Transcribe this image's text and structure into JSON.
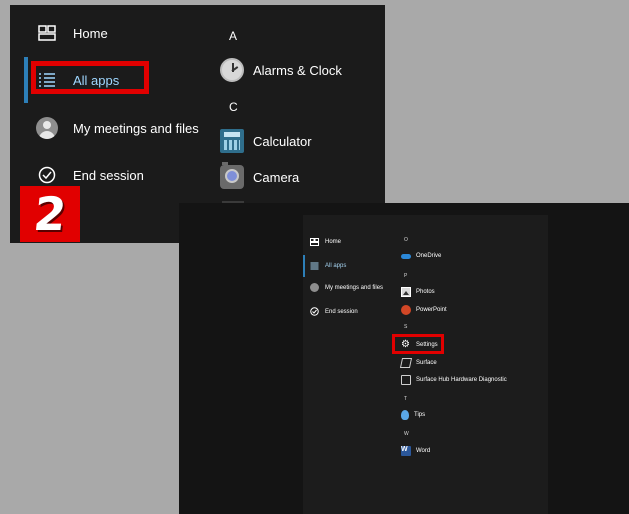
{
  "top_panel": {
    "nav": [
      {
        "label": "Home",
        "icon": "home-grid-icon"
      },
      {
        "label": "All apps",
        "icon": "list-icon",
        "active": true
      },
      {
        "label": "My meetings and files",
        "icon": "avatar-icon"
      },
      {
        "label": "End session",
        "icon": "check-circle-icon"
      }
    ],
    "letters": [
      "A",
      "C"
    ],
    "apps": [
      {
        "label": "Alarms & Clock",
        "icon": "clock-icon"
      },
      {
        "label": "Calculator",
        "icon": "calculator-icon"
      },
      {
        "label": "Camera",
        "icon": "camera-icon"
      }
    ],
    "step_badge": "2"
  },
  "bottom_panel": {
    "nav": [
      {
        "label": "Home",
        "icon": "home-grid-icon"
      },
      {
        "label": "All apps",
        "icon": "list-icon",
        "active": true
      },
      {
        "label": "My meetings and files",
        "icon": "avatar-icon"
      },
      {
        "label": "End session",
        "icon": "check-circle-icon"
      }
    ],
    "letters": [
      "O",
      "P",
      "S",
      "T",
      "W"
    ],
    "apps": [
      {
        "label": "OneDrive",
        "icon": "onedrive-icon"
      },
      {
        "label": "Photos",
        "icon": "photos-icon"
      },
      {
        "label": "PowerPoint",
        "icon": "powerpoint-icon"
      },
      {
        "label": "Settings",
        "icon": "gear-icon",
        "highlighted": true
      },
      {
        "label": "Surface",
        "icon": "surface-icon"
      },
      {
        "label": "Surface Hub Hardware Diagnostic",
        "icon": "hub-diagnostic-icon"
      },
      {
        "label": "Tips",
        "icon": "tips-icon"
      },
      {
        "label": "Word",
        "icon": "word-icon"
      }
    ]
  },
  "colors": {
    "highlight_red": "#e10000",
    "accent_blue": "#2d7fb8",
    "panel_dark": "#1b1b1b",
    "background_gray": "#a9a9a9"
  }
}
